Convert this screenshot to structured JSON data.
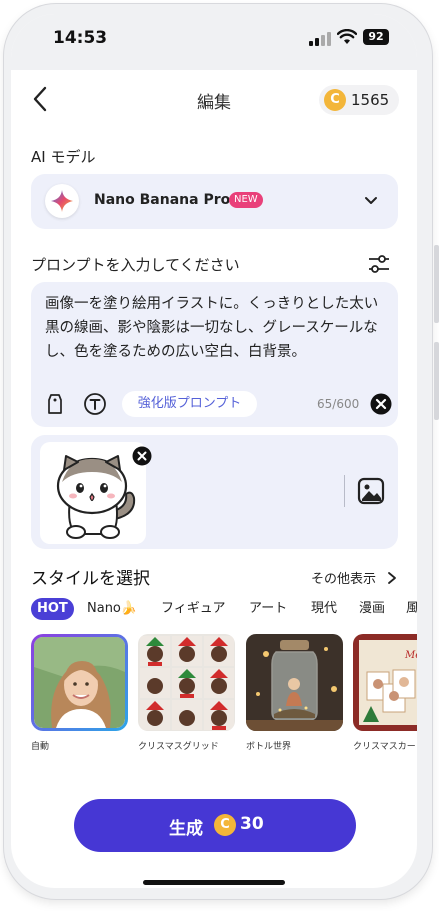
{
  "status_bar": {
    "time": "14:53",
    "battery": "92"
  },
  "header": {
    "title": "編集",
    "coin_balance": "1565",
    "coin_symbol": "C"
  },
  "ai_model": {
    "section_label": "AI モデル",
    "selected_model": "Nano Banana Pro",
    "badge": "NEW"
  },
  "prompt": {
    "section_label": "プロンプトを入力してください",
    "text": "画像一を塗り絵用イラストに。くっきりとした太い黒の線画、影や陰影は一切なし、グレースケールなし、色を塗るための広い空白、白背景。",
    "enhance_label": "強化版プロンプト",
    "char_count": "65/600"
  },
  "styles": {
    "section_label": "スタイルを選択",
    "see_more": "その他表示",
    "tabs": [
      "HOT",
      "Nano🍌",
      "フィギュア",
      "アート",
      "現代",
      "漫画",
      "風"
    ],
    "cards": [
      {
        "label": "自動",
        "selected": true
      },
      {
        "label": "クリスマスグリッド",
        "selected": false
      },
      {
        "label": "ボトル世界",
        "selected": false
      },
      {
        "label": "クリスマスカード",
        "selected": false
      }
    ],
    "card4_text": "Merry Christmas"
  },
  "generate": {
    "label": "生成",
    "coin_symbol": "C",
    "cost": "30"
  },
  "colors": {
    "accent": "#4637d4",
    "badge": "#e9407a",
    "coin": "#f3b63a",
    "panel": "#eef0fa"
  }
}
